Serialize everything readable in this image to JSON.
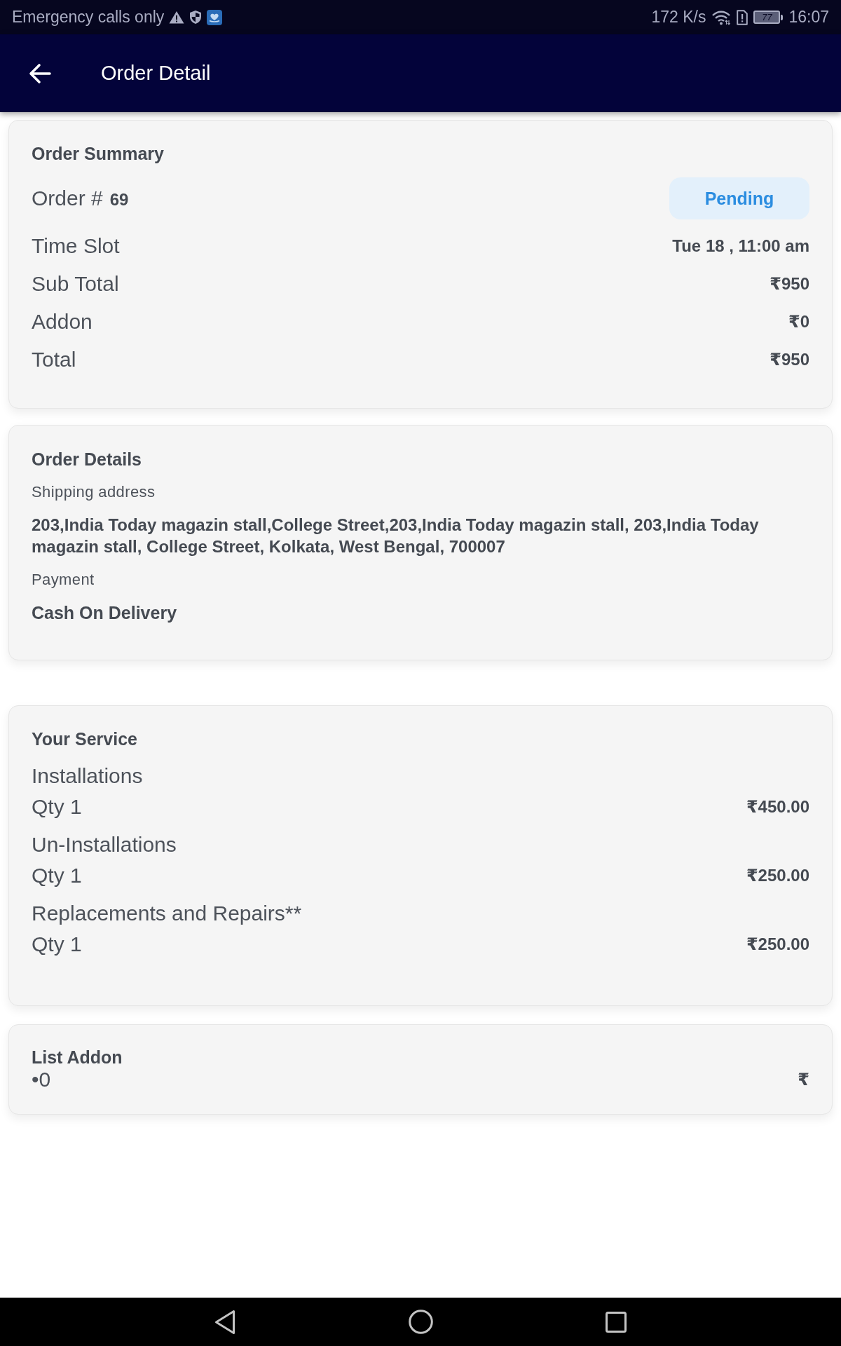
{
  "status_bar": {
    "notice": "Emergency calls only",
    "network_speed": "172 K/s",
    "battery": "77",
    "time": "16:07"
  },
  "app_bar": {
    "title": "Order Detail"
  },
  "order_summary": {
    "heading": "Order Summary",
    "order_label": "Order #",
    "order_number": "69",
    "status": "Pending",
    "rows": [
      {
        "label": "Time Slot",
        "value": "Tue 18 , 11:00 am"
      },
      {
        "label": "Sub Total",
        "value": "₹950"
      },
      {
        "label": "Addon",
        "value": "₹0"
      },
      {
        "label": "Total",
        "value": "₹950"
      }
    ]
  },
  "order_details": {
    "heading": "Order Details",
    "shipping_label": "Shipping address",
    "shipping_address": "203,India Today magazin stall,College Street,203,India Today magazin stall, 203,India Today magazin stall, College Street, Kolkata, West Bengal, 700007",
    "payment_label": "Payment",
    "payment_method": "Cash On Delivery"
  },
  "services": {
    "heading": "Your Service",
    "items": [
      {
        "name": "Installations",
        "quantity": "Qty 1",
        "price": "₹450.00"
      },
      {
        "name": "Un-Installations",
        "quantity": "Qty 1",
        "price": "₹250.00"
      },
      {
        "name": "Replacements and Repairs**",
        "quantity": "Qty 1",
        "price": "₹250.00"
      }
    ]
  },
  "addons": {
    "heading": "List Addon",
    "items": [
      {
        "name": "•0",
        "price": "₹"
      }
    ]
  }
}
